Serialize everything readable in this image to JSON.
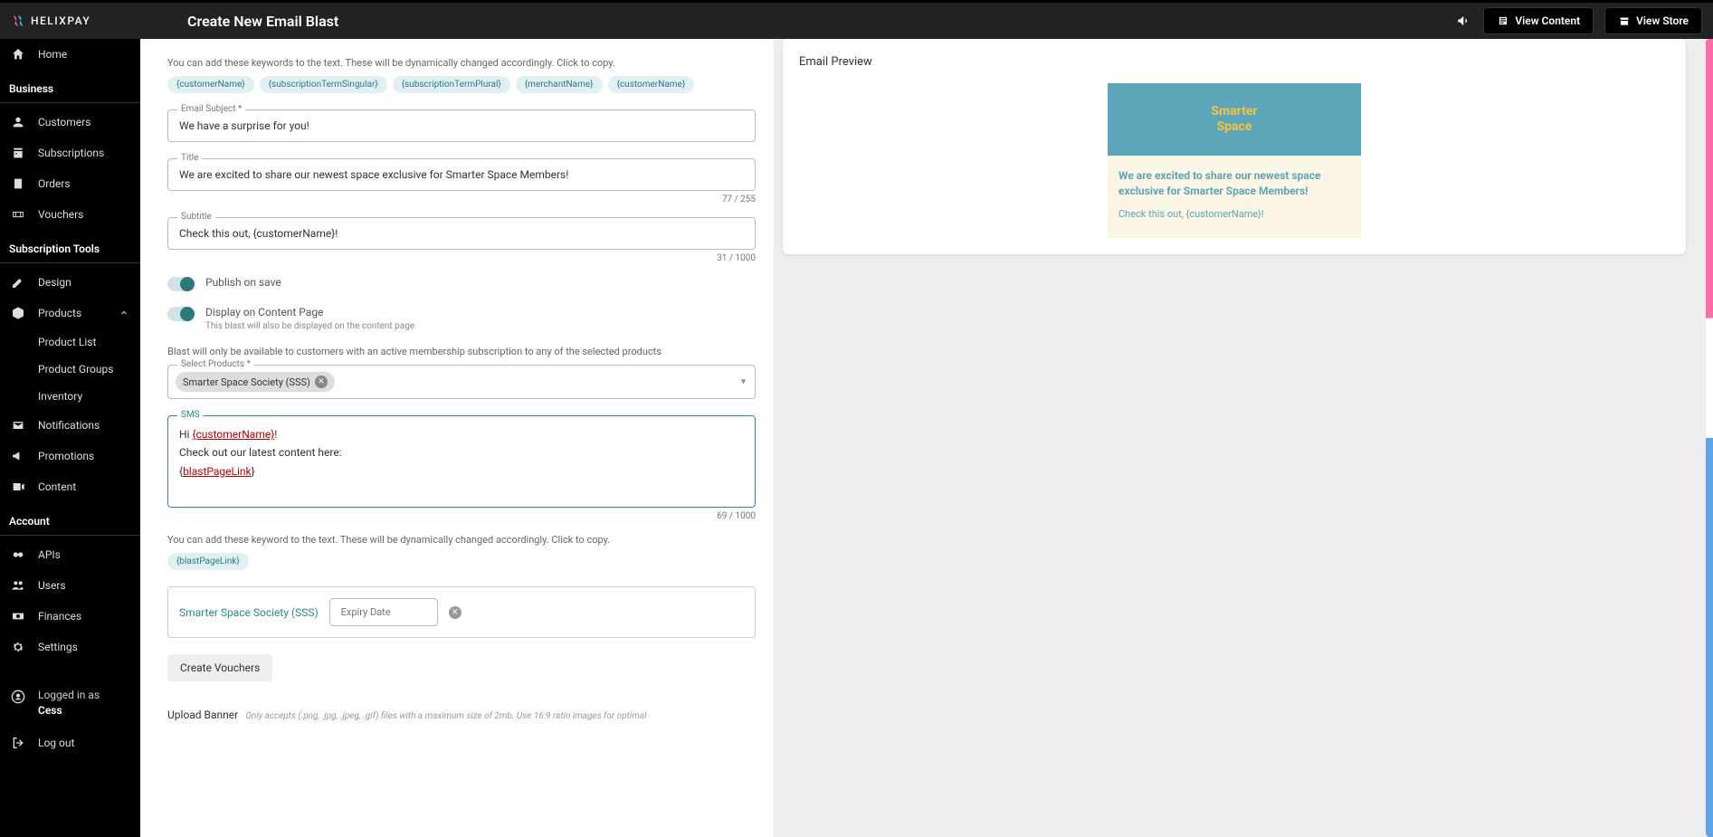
{
  "brand": "HELIXPAY",
  "pageTitle": "Create New Email Blast",
  "headerButtons": {
    "viewContent": "View Content",
    "viewStore": "View Store"
  },
  "sidebar": {
    "home": "Home",
    "sections": {
      "business": "Business",
      "subscriptionTools": "Subscription Tools",
      "account": "Account"
    },
    "items": {
      "customers": "Customers",
      "subscriptions": "Subscriptions",
      "orders": "Orders",
      "vouchers": "Vouchers",
      "design": "Design",
      "products": "Products",
      "productList": "Product List",
      "productGroups": "Product Groups",
      "inventory": "Inventory",
      "notifications": "Notifications",
      "promotions": "Promotions",
      "content": "Content",
      "apis": "APIs",
      "users": "Users",
      "finances": "Finances",
      "settings": "Settings",
      "logout": "Log out"
    },
    "user": {
      "loggedInAs": "Logged in as",
      "name": "Cess"
    }
  },
  "form": {
    "keywordHint": "You can add these keywords to the text. These will be dynamically changed accordingly. Click to copy.",
    "keywords": [
      "{customerName}",
      "{subscriptionTermSingular}",
      "{subscriptionTermPlural}",
      "{merchantName}",
      "{customerName}"
    ],
    "subject": {
      "label": "Email Subject *",
      "value": "We have a surprise for you!"
    },
    "title": {
      "label": "Title",
      "value": "We are excited to share our newest space exclusive for Smarter Space Members!",
      "counter": "77 / 255"
    },
    "subtitle": {
      "label": "Subtitle",
      "value": "Check this out, {customerName}!",
      "counter": "31 / 1000"
    },
    "toggles": {
      "publishOnSave": "Publish on save",
      "displayOnContent": "Display on Content Page",
      "displaySub": "This blast will also be displayed on the content page"
    },
    "productHint": "Blast will only be available to customers with an active membership subscription to any of the selected products",
    "selectProducts": {
      "label": "Select Products *",
      "chip": "Smarter Space Society (SSS)"
    },
    "sms": {
      "label": "SMS",
      "line1a": "Hi ",
      "line1b": "{customerName}",
      "line1c": "!",
      "line2": "Check out our latest content here:",
      "line3a": "{",
      "line3b": "blastPageLink",
      "line3c": "}",
      "counter": "69 / 1000"
    },
    "smsKeywordHint": "You can add these keyword to the text. These will be dynamically changed accordingly. Click to copy.",
    "smsKeywords": [
      "{blastPageLink}"
    ],
    "voucher": {
      "name": "Smarter Space Society (SSS)",
      "expiryPlaceholder": "Expiry Date"
    },
    "createVouchers": "Create Vouchers",
    "uploadBanner": "Upload Banner",
    "uploadHint": "Only accepts (.png, .jpg, .jpeg, .gif) files with a maximum size of 2mb. Use 16:9 ratio images for optimal"
  },
  "preview": {
    "heading": "Email Preview",
    "bannerLine1": "Smarter",
    "bannerLine2": "Space",
    "title": "We are excited to share our newest space exclusive for Smarter Space Members!",
    "subtitle": "Check this out, {customerName}!"
  }
}
